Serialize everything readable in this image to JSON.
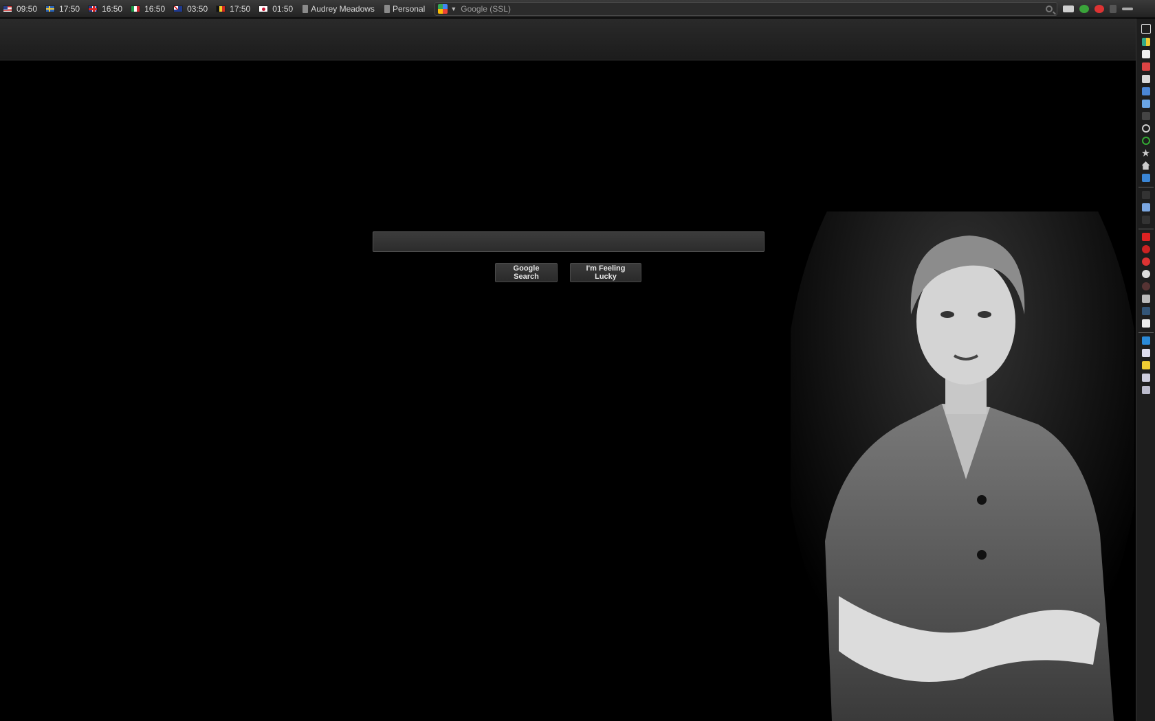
{
  "topbar": {
    "clocks": [
      {
        "flag": "us-flag",
        "time": "09:50"
      },
      {
        "flag": "se-flag",
        "time": "17:50"
      },
      {
        "flag": "gb-flag",
        "time": "16:50"
      },
      {
        "flag": "it-flag",
        "time": "16:50"
      },
      {
        "flag": "au-flag",
        "time": "03:50"
      },
      {
        "flag": "be-flag",
        "time": "17:50"
      },
      {
        "flag": "jp-flag",
        "time": "01:50"
      }
    ],
    "bookmarks": [
      "Audrey Meadows",
      "Personal"
    ],
    "url": "Google (SSL)"
  },
  "search": {
    "value": "",
    "placeholder": ""
  },
  "buttons": {
    "search": "Google Search",
    "lucky": "I'm Feeling Lucky"
  },
  "colors": {
    "background": "#000000",
    "chrome": "#2a2a2a",
    "text": "#d8d8d8"
  }
}
